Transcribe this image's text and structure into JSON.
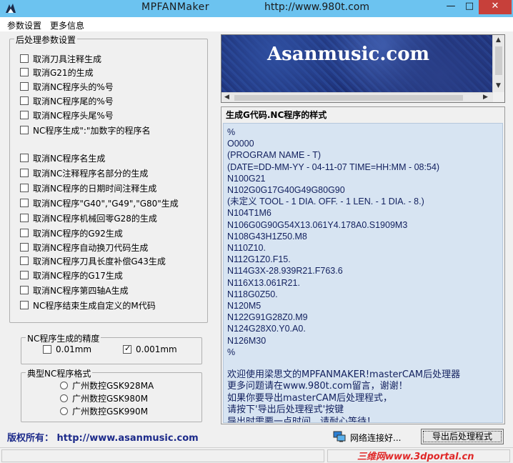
{
  "window": {
    "title": "MPFANMaker",
    "url": "http://www.980t.com",
    "minimize": "—",
    "maximize": "□",
    "close": "✕"
  },
  "menu": {
    "items": [
      "参数设置",
      "更多信息"
    ]
  },
  "post_settings": {
    "title": "后处理参数设置",
    "options_a": [
      {
        "label": "取消刀具注释生成",
        "checked": false
      },
      {
        "label": "取消G21的生成",
        "checked": false
      },
      {
        "label": "取消NC程序头的%号",
        "checked": false
      },
      {
        "label": "取消NC程序尾的%号",
        "checked": false
      },
      {
        "label": "取消NC程序头尾%号",
        "checked": false
      },
      {
        "label": "NC程序生成\":\"加数字的程序名",
        "checked": false
      }
    ],
    "options_b": [
      {
        "label": "取消NC程序名生成",
        "checked": false
      },
      {
        "label": "取消NC注释程序名部分的生成",
        "checked": false
      },
      {
        "label": "取消NC程序的日期时间注释生成",
        "checked": false
      },
      {
        "label": " 取消NC程序\"G40\",\"G49\",\"G80\"生成",
        "checked": false
      },
      {
        "label": "取消NC程序机械回零G28的生成",
        "checked": false
      },
      {
        "label": "取消NC程序的G92生成",
        "checked": false
      },
      {
        "label": "取消NC程序自动换刀代码生成",
        "checked": false
      },
      {
        "label": "取消NC程序刀具长度补偿G43生成",
        "checked": false
      },
      {
        "label": "取消NC程序的G17生成",
        "checked": false
      },
      {
        "label": "取消NC程序第四轴A生成",
        "checked": false
      },
      {
        "label": "NC程序结束生成自定义的M代码",
        "checked": false
      }
    ]
  },
  "precision": {
    "title": "NC程序生成的精度",
    "options": [
      {
        "label": "0.01mm",
        "checked": false
      },
      {
        "label": "0.001mm",
        "checked": true
      }
    ]
  },
  "format": {
    "title": "典型NC程序格式",
    "options": [
      "广州数控GSK928MA",
      "广州数控GSK980M",
      "广州数控GSK990M"
    ]
  },
  "banner": {
    "text": "Asanmusic.com"
  },
  "code": {
    "title": "生成G代码.NC程序的样式",
    "lines": [
      "%",
      "O0000",
      "(PROGRAM NAME - T)",
      "(DATE=DD-MM-YY - 04-11-07 TIME=HH:MM - 08:54)",
      "N100G21",
      "N102G0G17G40G49G80G90",
      "(未定义 TOOL - 1 DIA. OFF. - 1 LEN. - 1 DIA. - 8.)",
      "N104T1M6",
      "N106G0G90G54X13.061Y4.178A0.S1909M3",
      "N108G43H1Z50.M8",
      "N110Z10.",
      "N112G1Z0.F15.",
      "N114G3X-28.939R21.F763.6",
      "N116X13.061R21.",
      "N118G0Z50.",
      "N120M5",
      "N122G91G28Z0.M9",
      "N124G28X0.Y0.A0.",
      "N126M30",
      "%"
    ],
    "message": [
      "欢迎使用梁思文的MPFANMAKER!masterCAM后处理器",
      "更多问题请在www.980t.com留言，谢谢！",
      "如果你要导出masterCAM后处理程式，",
      "请按下'导出后处理程式'按键",
      "导出时需要一点时间，请耐心等待！"
    ]
  },
  "footer": {
    "copyright": "版权所有：  http://www.asanmusic.com",
    "network": "网络连接好...",
    "export_button": "导出后处理程式",
    "watermark": "三维网www.3dportal.cn"
  },
  "colors": {
    "title_bar": "#6cc3f0",
    "code_bg": "#d7e4f2",
    "code_text": "#12205e",
    "copyright": "#1c2a8a",
    "close": "#c7403a"
  }
}
